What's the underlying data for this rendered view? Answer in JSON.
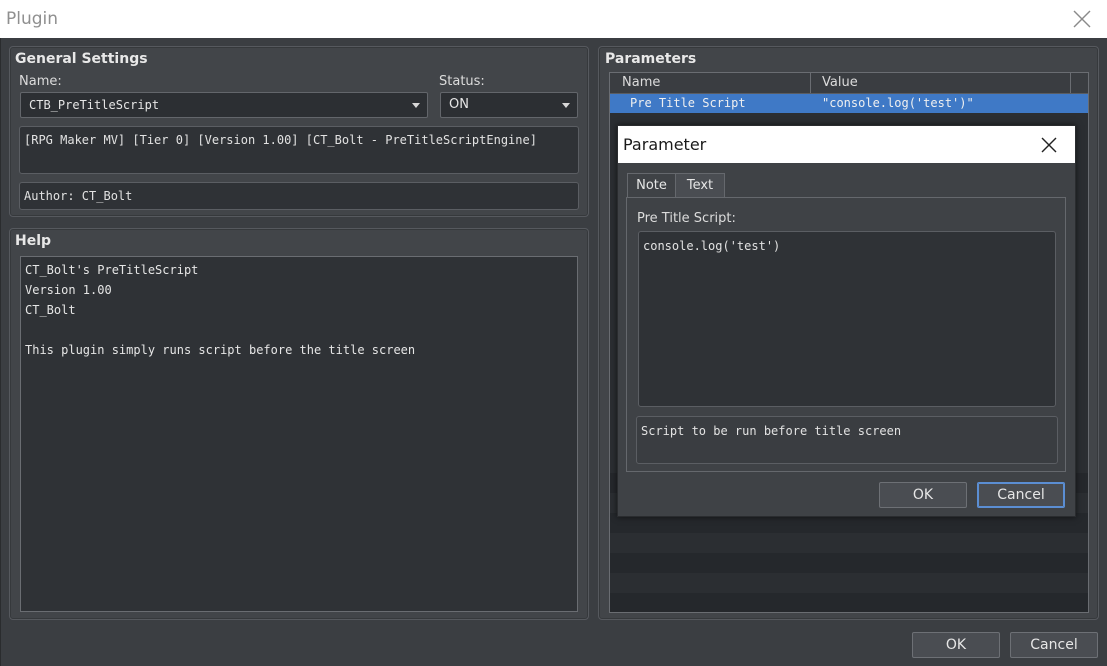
{
  "window": {
    "title": "Plugin"
  },
  "general": {
    "title": "General Settings",
    "name_label": "Name:",
    "name_value": "CTB_PreTitleScript",
    "status_label": "Status:",
    "status_value": "ON",
    "description": "[RPG Maker MV] [Tier 0] [Version 1.00] [CT_Bolt - PreTitleScriptEngine]",
    "author": "Author: CT_Bolt"
  },
  "help": {
    "title": "Help",
    "lines": [
      "CT_Bolt's PreTitleScript",
      "Version 1.00",
      "CT_Bolt",
      "",
      "This plugin simply runs script before the title screen"
    ]
  },
  "parameters": {
    "title": "Parameters",
    "columns": [
      "Name",
      "Value"
    ],
    "rows": [
      {
        "name": "Pre Title Script",
        "value": "\"console.log('test')\""
      }
    ]
  },
  "dialog": {
    "title": "Parameter",
    "tabs": [
      "Note",
      "Text"
    ],
    "field_label": "Pre Title Script:",
    "field_value": "console.log('test')",
    "note": "Script to be run before title screen",
    "ok_label": "OK",
    "cancel_label": "Cancel"
  },
  "footer": {
    "ok_label": "OK",
    "cancel_label": "Cancel"
  },
  "colors": {
    "selection": "#3f79c6",
    "focus": "#5b8ed3",
    "background": "#3a3d41"
  }
}
